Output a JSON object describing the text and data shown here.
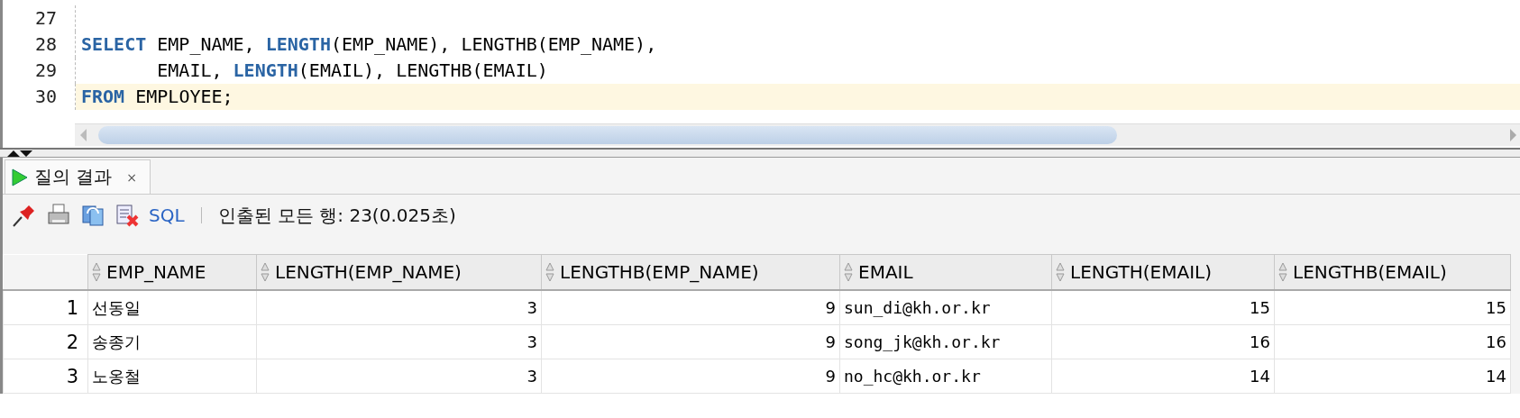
{
  "editor": {
    "lines": [
      {
        "number": "27",
        "current": false
      },
      {
        "number": "28",
        "current": false,
        "tokens": [
          {
            "kind": "keyword",
            "text": "SELECT"
          },
          {
            "kind": "plain",
            "text": " EMP_NAME, "
          },
          {
            "kind": "keyword",
            "text": "LENGTH"
          },
          {
            "kind": "plain",
            "text": "(EMP_NAME), LENGTHB(EMP_NAME),"
          }
        ]
      },
      {
        "number": "29",
        "current": false,
        "tokens": [
          {
            "kind": "plain",
            "text": "       EMAIL, "
          },
          {
            "kind": "keyword",
            "text": "LENGTH"
          },
          {
            "kind": "plain",
            "text": "(EMAIL), LENGTHB(EMAIL)"
          }
        ]
      },
      {
        "number": "30",
        "current": true,
        "tokens": [
          {
            "kind": "keyword",
            "text": "FROM"
          },
          {
            "kind": "plain",
            "text": " EMPLOYEE;"
          }
        ]
      }
    ]
  },
  "tabs": [
    {
      "label": "질의 결과",
      "close": "×",
      "selected": true
    }
  ],
  "toolbar": {
    "sql_link": "SQL",
    "status": "인출된 모든 행: 23(0.025초)"
  },
  "table": {
    "columns": [
      {
        "label": "EMP_NAME",
        "kind": "text"
      },
      {
        "label": "LENGTH(EMP_NAME)",
        "kind": "number"
      },
      {
        "label": "LENGTHB(EMP_NAME)",
        "kind": "number"
      },
      {
        "label": "EMAIL",
        "kind": "mono"
      },
      {
        "label": "LENGTH(EMAIL)",
        "kind": "number"
      },
      {
        "label": "LENGTHB(EMAIL)",
        "kind": "number"
      }
    ],
    "rows": [
      {
        "number": "1",
        "cells": [
          "선동일",
          "3",
          "9",
          "sun_di@kh.or.kr",
          "15",
          "15"
        ]
      },
      {
        "number": "2",
        "cells": [
          "송종기",
          "3",
          "9",
          "song_jk@kh.or.kr",
          "16",
          "16"
        ]
      },
      {
        "number": "3",
        "cells": [
          "노옹철",
          "3",
          "9",
          "no_hc@kh.or.kr",
          "14",
          "14"
        ]
      }
    ]
  }
}
